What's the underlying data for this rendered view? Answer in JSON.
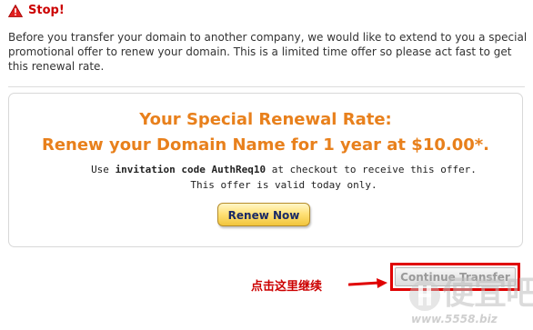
{
  "header": {
    "icon": "warning-icon",
    "title": "Stop!"
  },
  "intro": {
    "text": "Before you transfer your domain to another company, we would like to extend to you a special promotional offer to renew your domain. This is a limited time offer so please act fast to get this renewal rate."
  },
  "offer": {
    "heading_line1": "Your Special Renewal Rate:",
    "heading_line2": "Renew your Domain Name for 1 year at $10.00*.",
    "code_prefix": "Use ",
    "code_label": "invitation code AuthReq10",
    "code_suffix": " at checkout to receive this offer.",
    "valid_text": "This offer is valid today only.",
    "renew_button": "Renew Now"
  },
  "annotation": {
    "note": "点击这里继续",
    "arrow": "arrow-right-icon"
  },
  "actions": {
    "continue_button": "Continue Transfer"
  },
  "watermark": {
    "logo": "watermark-logo-icon",
    "text": "便宜吧",
    "url": "www.5558.biz"
  },
  "colors": {
    "stop_red": "#cc0000",
    "offer_orange": "#e8801c",
    "highlight_red": "#e00000",
    "button_gold": "#ffe27a"
  }
}
